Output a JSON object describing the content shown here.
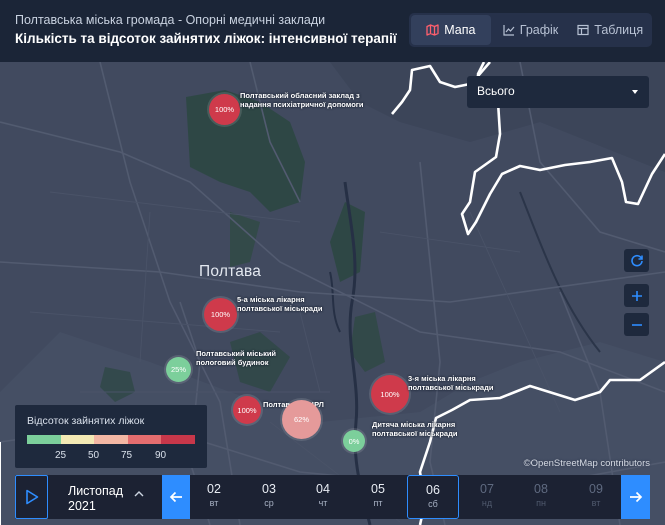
{
  "header": {
    "supertitle": "Полтавська міська громада - Опорні медичні заклади",
    "title": "Кількість та відсоток зайнятих ліжок: інтенсивної терапії",
    "views": [
      {
        "label": "Мапа",
        "icon": "map-icon",
        "active": true
      },
      {
        "label": "Графік",
        "icon": "line-chart-icon",
        "active": false
      },
      {
        "label": "Таблиця",
        "icon": "table-icon",
        "active": false
      }
    ]
  },
  "map": {
    "city_label": "Полтава",
    "filter": {
      "selected": "Всього"
    },
    "attribution": "©OpenStreetMap contributors",
    "markers": [
      {
        "value": "100%",
        "label": "Полтавський обласний заклад з надання психіатричної допомоги"
      },
      {
        "value": "100%",
        "label": "5-а міська лікарня полтавської міськради"
      },
      {
        "value": "25%",
        "label": "Полтавський міський пологовий будинок"
      },
      {
        "value": "100%",
        "label": "Полтавська ЦРЛ"
      },
      {
        "value": "62%",
        "label": ""
      },
      {
        "value": "100%",
        "label": "3-я міська лікарня полтавської міськради"
      },
      {
        "value": "0%",
        "label": "Дитяча міська лікарня полтавської міськради"
      }
    ],
    "colors": {
      "full": "#d03a4c",
      "high": "#e59a9a",
      "low": "#7ccf9b",
      "accent": "#2e8dff"
    }
  },
  "legend": {
    "title": "Відсоток зайнятих ліжок",
    "colors": [
      "#7ccf9b",
      "#f3e9b4",
      "#f3b7a4",
      "#e46d6f",
      "#c8374a"
    ],
    "ticks": [
      "25",
      "50",
      "75",
      "90"
    ]
  },
  "timeline": {
    "month": "Листопад",
    "year": "2021",
    "days": [
      {
        "num": "02",
        "wd": "вт"
      },
      {
        "num": "03",
        "wd": "ср"
      },
      {
        "num": "04",
        "wd": "чт"
      },
      {
        "num": "05",
        "wd": "пт"
      },
      {
        "num": "06",
        "wd": "сб"
      },
      {
        "num": "07",
        "wd": "нд"
      },
      {
        "num": "08",
        "wd": "пн"
      },
      {
        "num": "09",
        "wd": "вт"
      }
    ]
  }
}
